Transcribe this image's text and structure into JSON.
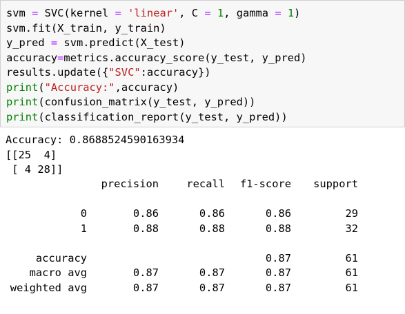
{
  "code_cell": {
    "lines": [
      [
        {
          "t": "svm ",
          "c": ""
        },
        {
          "t": "=",
          "c": "op"
        },
        {
          "t": " SVC(kernel ",
          "c": ""
        },
        {
          "t": "=",
          "c": "op"
        },
        {
          "t": " ",
          "c": ""
        },
        {
          "t": "'linear'",
          "c": "str"
        },
        {
          "t": ", C ",
          "c": ""
        },
        {
          "t": "=",
          "c": "op"
        },
        {
          "t": " ",
          "c": ""
        },
        {
          "t": "1",
          "c": "num"
        },
        {
          "t": ", gamma ",
          "c": ""
        },
        {
          "t": "=",
          "c": "op"
        },
        {
          "t": " ",
          "c": ""
        },
        {
          "t": "1",
          "c": "num"
        },
        {
          "t": ")",
          "c": ""
        }
      ],
      [
        {
          "t": "svm.fit(X_train, y_train)",
          "c": ""
        }
      ],
      [
        {
          "t": "y_pred ",
          "c": ""
        },
        {
          "t": "=",
          "c": "op"
        },
        {
          "t": " svm.predict(X_test)",
          "c": ""
        }
      ],
      [
        {
          "t": "accuracy",
          "c": ""
        },
        {
          "t": "=",
          "c": "op"
        },
        {
          "t": "metrics.accuracy_score(y_test, y_pred)",
          "c": ""
        }
      ],
      [
        {
          "t": "results.update({",
          "c": ""
        },
        {
          "t": "\"SVC\"",
          "c": "str"
        },
        {
          "t": ":accuracy})",
          "c": ""
        }
      ],
      [
        {
          "t": "print",
          "c": "kw"
        },
        {
          "t": "(",
          "c": ""
        },
        {
          "t": "\"Accuracy:\"",
          "c": "str"
        },
        {
          "t": ",accuracy)",
          "c": ""
        }
      ],
      [
        {
          "t": "print",
          "c": "kw"
        },
        {
          "t": "(confusion_matrix(y_test, y_pred))",
          "c": ""
        }
      ],
      [
        {
          "t": "print",
          "c": "kw"
        },
        {
          "t": "(classification_report(y_test, y_pred))",
          "c": ""
        }
      ]
    ]
  },
  "output": {
    "accuracy_line": "Accuracy: 0.8688524590163934",
    "matrix_line_1": "[[25  4]",
    "matrix_line_2": " [ 4 28]]",
    "report": {
      "headers": [
        "",
        "precision",
        "recall",
        "f1-score",
        "support"
      ],
      "rows": [
        [
          "",
          "",
          "",
          "",
          ""
        ],
        [
          "0",
          "0.86",
          "0.86",
          "0.86",
          "29"
        ],
        [
          "1",
          "0.88",
          "0.88",
          "0.88",
          "32"
        ],
        [
          "",
          "",
          "",
          "",
          ""
        ],
        [
          "accuracy",
          "",
          "",
          "0.87",
          "61"
        ],
        [
          "macro avg",
          "0.87",
          "0.87",
          "0.87",
          "61"
        ],
        [
          "weighted avg",
          "0.87",
          "0.87",
          "0.87",
          "61"
        ]
      ]
    }
  },
  "colors": {
    "operator": "#aa22ff",
    "string": "#ba2121",
    "number": "#008000",
    "builtin": "#008000",
    "cell_background": "#f7f7f7",
    "cell_border": "#cfcfcf"
  }
}
